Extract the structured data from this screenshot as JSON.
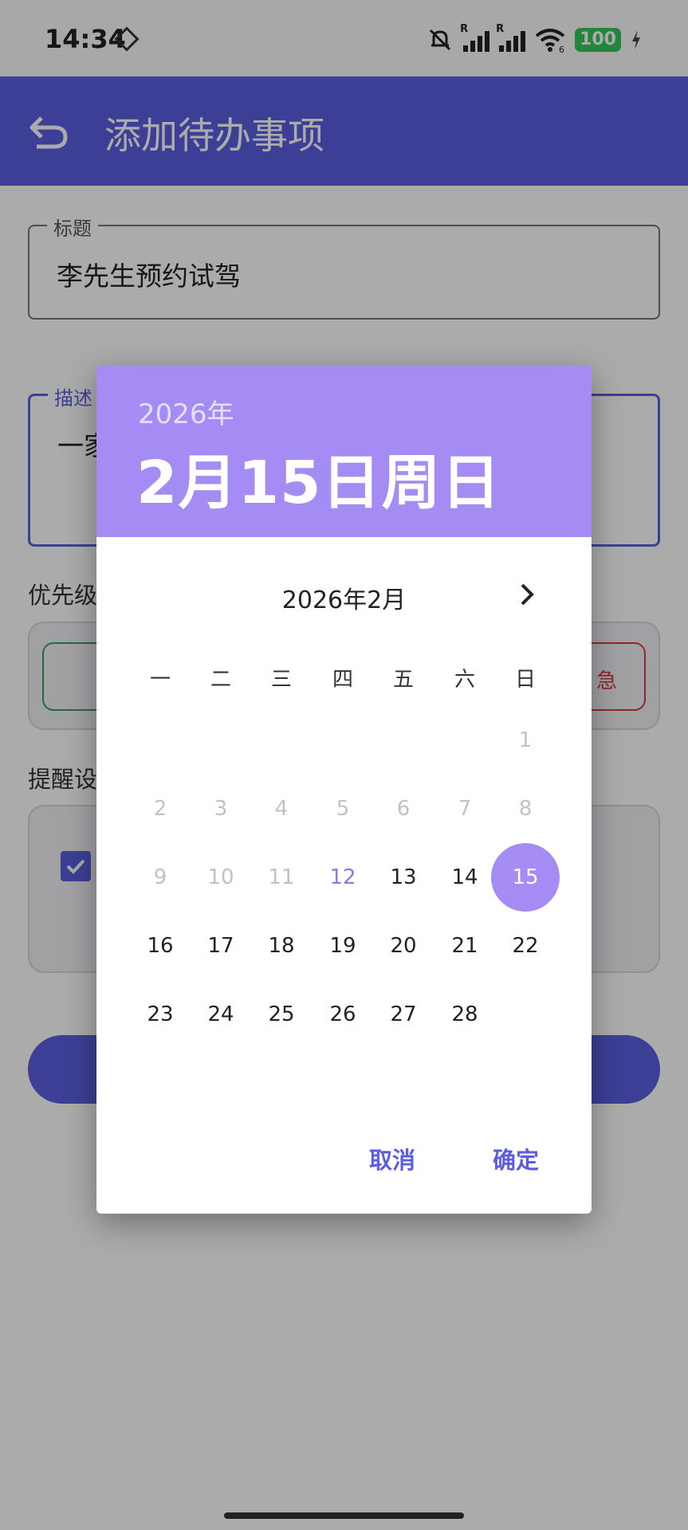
{
  "status_bar": {
    "time": "14:34",
    "icons": [
      "focus-mode-icon",
      "bell-off-icon",
      "signal-r-icon",
      "signal-r-icon",
      "wifi-icon",
      "battery-icon",
      "charging-icon"
    ],
    "battery": "100",
    "signal_roaming_label": "R",
    "wifi_generation": "6"
  },
  "app_bar": {
    "title": "添加待办事项",
    "back_icon": "back-arrow-icon"
  },
  "form": {
    "title_label": "标题",
    "title_value": "李先生预约试驾",
    "description_label": "描述",
    "description_value": "一家",
    "priority_section": "优先级",
    "reminder_section": "提醒设",
    "priority_option_right_partial": "急"
  },
  "date_picker": {
    "header_year": "2026年",
    "header_date": "2月15日周日",
    "month_label": "2026年2月",
    "weekdays": [
      "一",
      "二",
      "三",
      "四",
      "五",
      "六",
      "日"
    ],
    "first_day_column": 6,
    "days_in_month": 28,
    "today": 12,
    "selected": 15,
    "min_selectable": 12,
    "cancel_label": "取消",
    "confirm_label": "确定"
  },
  "colors": {
    "primary": "#5b5ee0",
    "picker_header": "#a58cf5",
    "priority_low_border": "#2e9e6a",
    "priority_high_border": "#d83b3b"
  }
}
